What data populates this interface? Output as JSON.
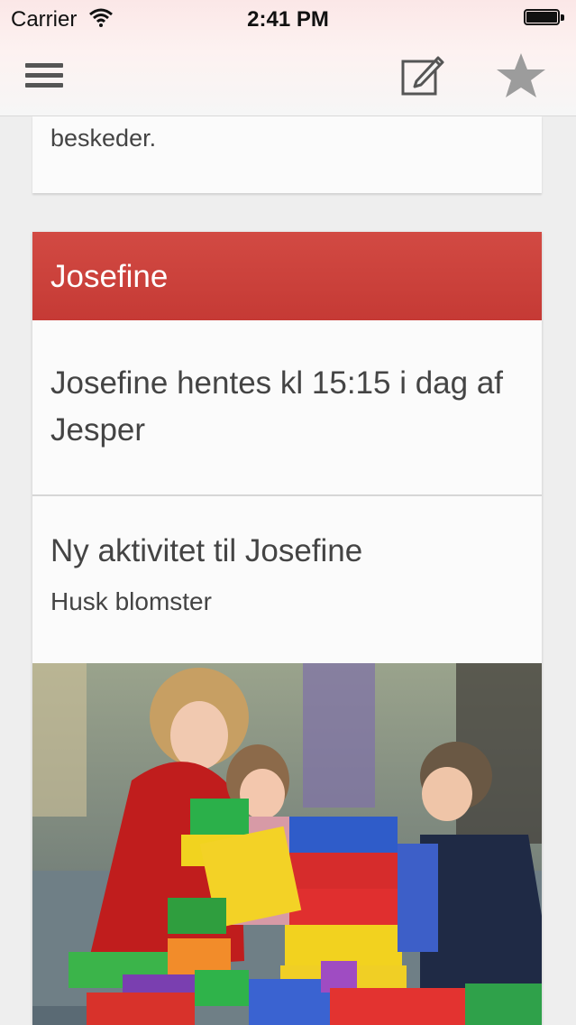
{
  "status_bar": {
    "carrier": "Carrier",
    "time": "2:41 PM"
  },
  "nav": {
    "menu_icon": "hamburger-menu-icon",
    "compose_icon": "compose-edit-icon",
    "favorite_icon": "star-icon"
  },
  "feed": {
    "previous_card_text": "beskeder.",
    "group": {
      "title": "Josefine",
      "accent_color": "#c9403a",
      "messages": [
        {
          "body": "Josefine hentes kl 15:15 i dag af Jesper"
        },
        {
          "title": "Ny aktivitet til Josefine",
          "subtitle": "Husk blomster"
        }
      ]
    }
  }
}
